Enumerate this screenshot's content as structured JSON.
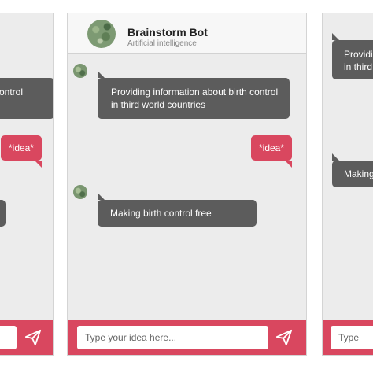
{
  "header": {
    "title": "Brainstorm Bot",
    "subtitle": "Artificial intelligence"
  },
  "messages": [
    {
      "sender": "bot",
      "text": "Providing information about birth control in third world countries"
    },
    {
      "sender": "user",
      "text": "*idea*"
    },
    {
      "sender": "bot",
      "text": "Making birth control free"
    }
  ],
  "left_panel": {
    "bot_fragment_1": "ontrol",
    "user_bubble": "*idea*"
  },
  "right_panel": {
    "bot_fragment_1": "Providi",
    "bot_fragment_2": "in third",
    "bot_fragment_3": "Making",
    "input_fragment": "Type"
  },
  "input": {
    "placeholder": "Type your idea here..."
  },
  "icons": {
    "send": "send-icon",
    "bot_avatar": "bot-avatar"
  },
  "colors": {
    "accent": "#d9475f",
    "bot_bubble": "#5c5c5c",
    "panel_bg": "#ececec",
    "header_bg": "#f7f7f7"
  }
}
